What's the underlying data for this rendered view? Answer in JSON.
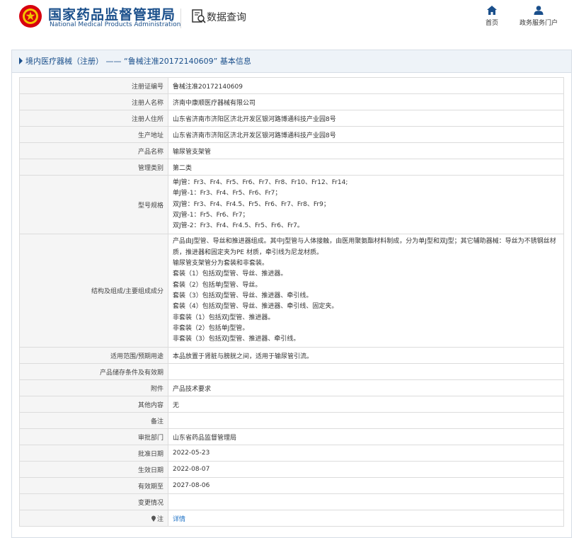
{
  "header": {
    "brand_cn": "国家药品监督管理局",
    "brand_en": "National Medical Products Administration",
    "query_title": "数据查询",
    "nav": {
      "home": "首页",
      "gov_service": "政务服务门户"
    }
  },
  "panel": {
    "title": "境内医疗器械（注册） —— “鲁械注准20172140609” 基本信息"
  },
  "fields": {
    "reg_no": {
      "label": "注册证编号",
      "value": "鲁械注准20172140609"
    },
    "registrant": {
      "label": "注册人名称",
      "value": "济南中康顺医疗器械有限公司"
    },
    "registrant_addr": {
      "label": "注册人住所",
      "value": "山东省济南市济阳区济北开发区银河路博通科技产业园8号"
    },
    "production_addr": {
      "label": "生产地址",
      "value": "山东省济南市济阳区济北开发区银河路博通科技产业园8号"
    },
    "product_name": {
      "label": "产品名称",
      "value": "输尿管支架管"
    },
    "category": {
      "label": "管理类别",
      "value": "第二类"
    },
    "models": {
      "label": "型号规格",
      "lines": [
        "单J管：Fr3、Fr4、Fr5、Fr6、Fr7、Fr8、Fr10、Fr12、Fr14;",
        "单J管-1：Fr3、Fr4、Fr5、Fr6、Fr7；",
        "双J管：Fr3、Fr4、Fr4.5、Fr5、Fr6、Fr7、Fr8、Fr9；",
        "双J管-1：Fr5、Fr6、Fr7；",
        "双J管-2：Fr3、Fr4、Fr4.5、Fr5、Fr6、Fr7。"
      ]
    },
    "structure": {
      "label": "结构及组成/主要组成成分",
      "lines": [
        "产品由J型管、导丝和推进器组成。其中J型管与人体接触，由医用聚氨酯材料制成，分为单J型和双J型；其它辅助器械：导丝为不锈钢丝材质，推进器和固定夹为PE 材质，牵引线为尼龙材质。",
        "输尿管支架管分为套装和非套装。",
        "套装（1）包括双J型管、导丝、推进器。",
        "套装（2）包括单J型管、导丝。",
        "套装（3）包括双J型管、导丝、推进器、牵引线。",
        "套装（4）包括双J型管、导丝、推进器、牵引线、固定夹。",
        "非套装（1）包括双J型管、推进器。",
        "非套装（2）包括单J型管。",
        "非套装（3）包括双J型管、推进器、牵引线。"
      ]
    },
    "intended_use": {
      "label": "适用范围/预期用途",
      "value": "本品放置于肾脏与膀胱之间，适用于输尿管引流。"
    },
    "storage": {
      "label": "产品储存条件及有效期",
      "value": ""
    },
    "attachment": {
      "label": "附件",
      "value": "产品技术要求"
    },
    "other": {
      "label": "其他内容",
      "value": "无"
    },
    "remark": {
      "label": "备注",
      "value": ""
    },
    "approval_dept": {
      "label": "审批部门",
      "value": "山东省药品监督管理局"
    },
    "approval_date": {
      "label": "批准日期",
      "value": "2022-05-23"
    },
    "effective_date": {
      "label": "生效日期",
      "value": "2022-08-07"
    },
    "expiry_date": {
      "label": "有效期至",
      "value": "2027-08-06"
    },
    "change": {
      "label": "变更情况",
      "value": ""
    },
    "note": {
      "label": "注",
      "link": "详情"
    }
  },
  "colors": {
    "brand_blue": "#1a4f8b",
    "emblem_red": "#d7000f",
    "link_blue": "#1a6fc4"
  }
}
